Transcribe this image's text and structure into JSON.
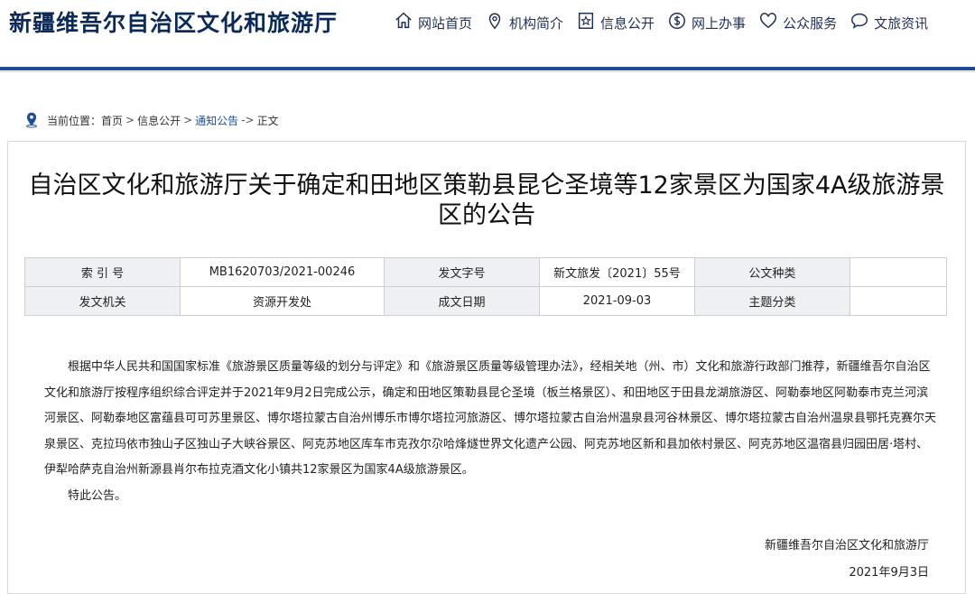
{
  "header": {
    "site_title": "新疆维吾尔自治区文化和旅游厅",
    "nav": [
      {
        "label": "网站首页",
        "icon": "home-icon"
      },
      {
        "label": "机构简介",
        "icon": "location-pin-icon"
      },
      {
        "label": "信息公开",
        "icon": "star-document-icon"
      },
      {
        "label": "网上办事",
        "icon": "dollar-circle-icon"
      },
      {
        "label": "公众服务",
        "icon": "heart-icon"
      },
      {
        "label": "文旅资讯",
        "icon": "chat-bubble-icon"
      }
    ]
  },
  "breadcrumb": {
    "prefix": "当前位置：",
    "items": [
      "首页",
      "信息公开",
      "通知公告",
      "正文"
    ],
    "separators": [
      ">",
      ">",
      "->"
    ]
  },
  "article": {
    "title": "自治区文化和旅游厅关于确定和田地区策勒县昆仑圣境等12家景区为国家4A级旅游景区的公告",
    "meta": {
      "row1": [
        {
          "key": "索 引 号",
          "value": "MB1620703/2021-00246"
        },
        {
          "key": "发文字号",
          "value": "新文旅发〔2021〕55号"
        },
        {
          "key": "公文种类",
          "value": ""
        }
      ],
      "row2": [
        {
          "key": "发文机关",
          "value": "资源开发处"
        },
        {
          "key": "成文日期",
          "value": "2021-09-03"
        },
        {
          "key": "主题分类",
          "value": ""
        }
      ]
    },
    "paragraph_1": "根据中华人民共和国国家标准《旅游景区质量等级的划分与评定》和《旅游景区质量等级管理办法》，经相关地（州、市）文化和旅游行政部门推荐，新疆维吾尔自治区文化和旅游厅按程序组织综合评定并于2021年9月2日完成公示，确定和田地区策勒县昆仑圣境（板兰格景区）、和田地区于田县龙湖旅游区、阿勒泰地区阿勒泰市克兰河滨河景区、阿勒泰地区富蕴县可可苏里景区、博尔塔拉蒙古自治州博乐市博尔塔拉河旅游区、博尔塔拉蒙古自治州温泉县河谷林景区、博尔塔拉蒙古自治州温泉县鄂托克赛尔天泉景区、克拉玛依市独山子区独山子大峡谷景区、阿克苏地区库车市克孜尔尕哈烽燧世界文化遗产公园、阿克苏地区新和县加依村景区、阿克苏地区温宿县归园田居·塔村、伊犁哈萨克自治州新源县肖尔布拉克酒文化小镇共12家景区为国家4A级旅游景区。",
    "paragraph_2": "特此公告。",
    "sign_org": "新疆维吾尔自治区文化和旅游厅",
    "sign_date": "2021年9月3日"
  },
  "colors": {
    "accent": "#1f4d97",
    "title": "#0b2a5a",
    "table_key_bg": "#eef0f3"
  }
}
